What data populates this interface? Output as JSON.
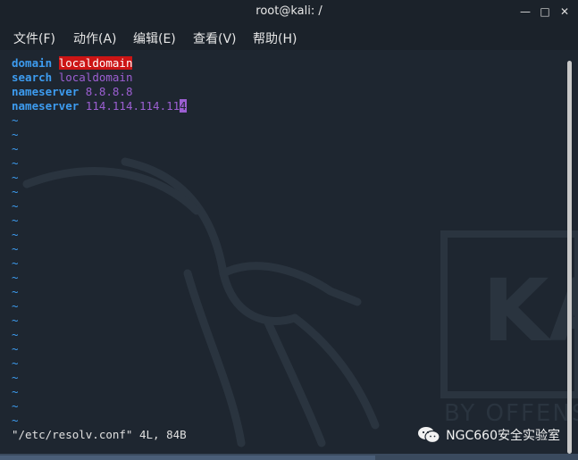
{
  "window": {
    "title": "root@kali: /",
    "minimize_glyph": "—",
    "maximize_glyph": "□",
    "close_glyph": "✕"
  },
  "menu": [
    {
      "label": "文件(F)"
    },
    {
      "label": "动作(A)"
    },
    {
      "label": "编辑(E)"
    },
    {
      "label": "查看(V)"
    },
    {
      "label": "帮助(H)"
    }
  ],
  "editor": {
    "lines": [
      {
        "keyword": "domain",
        "value": "localdomain"
      },
      {
        "keyword": "search",
        "value": "localdomain"
      },
      {
        "keyword": "nameserver",
        "value": "8.8.8.8"
      },
      {
        "keyword": "nameserver",
        "value_before_cursor": "114.114.114.11",
        "cursor_char": "4"
      }
    ],
    "tilde": "~",
    "status": "\"/etc/resolv.conf\" 4L, 84B"
  },
  "background_brand": {
    "text": "BY OFFENS",
    "letters": "KA"
  },
  "watermark": {
    "text": "NGC660安全实验室",
    "icon": "wechat-icon"
  },
  "colors": {
    "keyword": "#3d9cf0",
    "value": "#9c5fd2",
    "highlight": "#cc1515",
    "background": "#1e2630"
  }
}
